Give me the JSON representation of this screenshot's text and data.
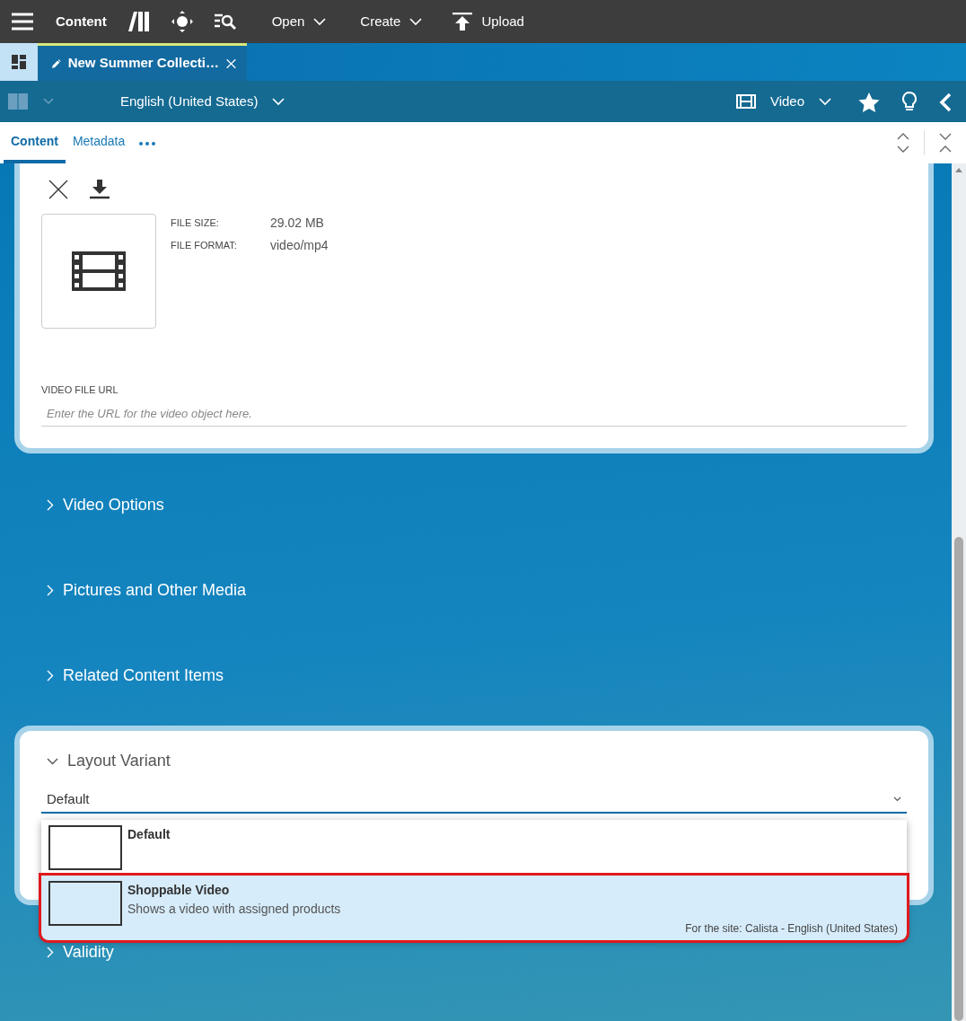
{
  "app_bar": {
    "title": "Content",
    "menus": [
      {
        "label": "Open"
      },
      {
        "label": "Create"
      }
    ],
    "upload": "Upload"
  },
  "document_tabs": [
    {
      "label": "New Summer Collecti…",
      "selected": true
    }
  ],
  "editor_toolbar": {
    "locale": "English (United States)",
    "content_type": "Video"
  },
  "view_tabs": [
    {
      "label": "Content",
      "selected": true
    },
    {
      "label": "Metadata",
      "selected": false
    }
  ],
  "media": {
    "file_size_label": "FILE SIZE:",
    "file_size": "29.02 MB",
    "file_format_label": "FILE FORMAT:",
    "file_format": "video/mp4",
    "url_label": "VIDEO FILE URL",
    "url_placeholder": "Enter the URL for the video object here."
  },
  "sections": [
    {
      "title": "Video Options",
      "expanded": false
    },
    {
      "title": "Pictures and Other Media",
      "expanded": false
    },
    {
      "title": "Related Content Items",
      "expanded": false
    },
    {
      "title": "Layout Variant",
      "expanded": true,
      "value": "Default",
      "options": [
        {
          "title": "Default",
          "highlighted": false
        },
        {
          "title": "Shoppable Video",
          "description": "Shows a video with assigned products",
          "site": "For the site: Calista - English (United States)",
          "highlighted": true
        }
      ]
    },
    {
      "title": "Validity",
      "expanded": false
    }
  ]
}
